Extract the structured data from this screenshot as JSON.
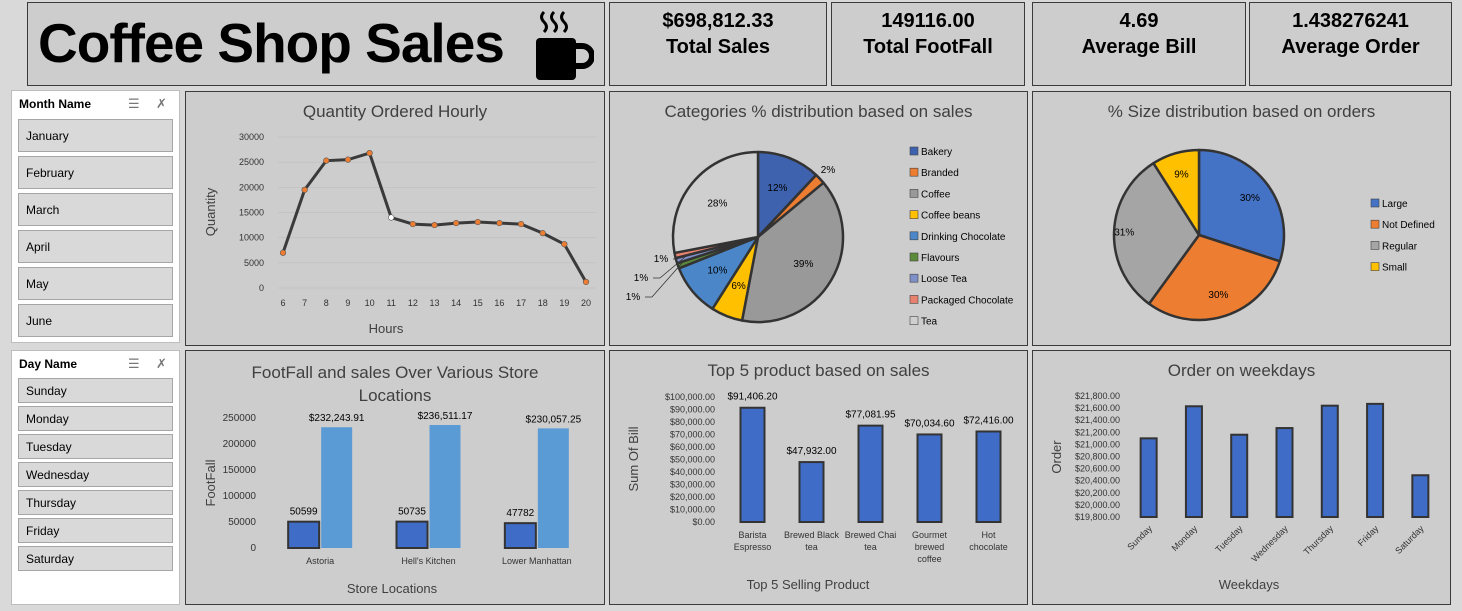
{
  "header": {
    "title": "Coffee Shop Sales",
    "icon": "coffee-cup-icon"
  },
  "kpis": [
    {
      "value": "$698,812.33",
      "label": "Total Sales"
    },
    {
      "value": "149116.00",
      "label": "Total FootFall"
    },
    {
      "value": "4.69",
      "label": "Average Bill"
    },
    {
      "value": "1.438276241",
      "label": "Average Order"
    }
  ],
  "slicer_month": {
    "title": "Month Name",
    "items": [
      "January",
      "February",
      "March",
      "April",
      "May",
      "June"
    ]
  },
  "slicer_day": {
    "title": "Day Name",
    "items": [
      "Sunday",
      "Monday",
      "Tuesday",
      "Wednesday",
      "Thursday",
      "Friday",
      "Saturday"
    ]
  },
  "colors": {
    "blue": "#4472c4",
    "orange": "#ed7d31",
    "gray": "#a5a5a5",
    "yellow": "#ffc000",
    "light_blue": "#5b9bd5",
    "green": "#70ad47",
    "bar_blue": "#3f6cc7"
  },
  "chart_data": [
    {
      "id": "hourly",
      "type": "line",
      "title": "Quantity Ordered Hourly",
      "xlabel": "Hours",
      "ylabel": "Quantity",
      "x": [
        6,
        7,
        8,
        9,
        10,
        11,
        12,
        13,
        14,
        15,
        16,
        17,
        18,
        19,
        20
      ],
      "values": [
        7000,
        19500,
        25300,
        25500,
        26800,
        14000,
        12700,
        12500,
        12900,
        13100,
        12900,
        12700,
        10900,
        8700,
        1200
      ],
      "yticks": [
        "0",
        "5000",
        "10000",
        "15000",
        "20000",
        "25000",
        "30000"
      ],
      "ylim": [
        0,
        30000
      ]
    },
    {
      "id": "categories",
      "type": "pie",
      "title": "Categories % distribution based on sales",
      "categories": [
        "Bakery",
        "Branded",
        "Coffee",
        "Coffee beans",
        "Drinking Chocolate",
        "Flavours",
        "Loose Tea",
        "Packaged Chocolate",
        "Tea"
      ],
      "values": [
        12,
        2,
        39,
        6,
        10,
        1,
        1,
        1,
        28
      ],
      "labels": [
        "12%",
        "2%",
        "39%",
        "6%",
        "10%",
        "1%",
        "1%",
        "1%",
        "28%"
      ],
      "colors": [
        "#3e62ad",
        "#ed7d31",
        "#999999",
        "#ffc000",
        "#4a86c8",
        "#5b8a3a",
        "#7f8fc8",
        "#e8826f",
        "#cfcfcf"
      ],
      "legend": "right"
    },
    {
      "id": "sizes",
      "type": "pie",
      "title": "% Size distribution based on orders",
      "categories": [
        "Large",
        "Not Defined",
        "Regular",
        "Small"
      ],
      "values": [
        30,
        30,
        31,
        9
      ],
      "labels": [
        "30%",
        "30%",
        "31%",
        "9%"
      ],
      "colors": [
        "#4472c4",
        "#ed7d31",
        "#a5a5a5",
        "#ffc000"
      ],
      "legend": "right"
    },
    {
      "id": "footfall",
      "type": "bar",
      "title": "FootFall and sales Over Various Store Locations",
      "xlabel": "Store Locations",
      "ylabel": "FootFall",
      "categories": [
        "Astoria",
        "Hell's Kitchen",
        "Lower Manhattan"
      ],
      "series": [
        {
          "values": [
            50599,
            50735,
            47782
          ],
          "labels": [
            "50599",
            "50735",
            "47782"
          ]
        },
        {
          "values": [
            232243.91,
            236511.17,
            230057.25
          ],
          "labels": [
            "$232,243.91",
            "$236,511.17",
            "$230,057.25"
          ]
        }
      ],
      "yticks": [
        "0",
        "50000",
        "100000",
        "150000",
        "200000",
        "250000"
      ],
      "ylim": [
        0,
        250000
      ]
    },
    {
      "id": "top5",
      "type": "bar",
      "title": "Top 5 product based on sales",
      "xlabel": "Top 5 Selling Product",
      "ylabel": "Sum Of Bill",
      "categories": [
        [
          "Barista",
          "Espresso"
        ],
        [
          "Brewed Black",
          "tea"
        ],
        [
          "Brewed Chai",
          "tea"
        ],
        [
          "Gourmet",
          "brewed",
          "coffee"
        ],
        [
          "Hot",
          "chocolate"
        ]
      ],
      "values": [
        91406.2,
        47932.0,
        77081.95,
        70034.6,
        72416.0
      ],
      "labels": [
        "$91,406.20",
        "$47,932.00",
        "$77,081.95",
        "$70,034.60",
        "$72,416.00"
      ],
      "yticks": [
        "$0.00",
        "$10,000.00",
        "$20,000.00",
        "$30,000.00",
        "$40,000.00",
        "$50,000.00",
        "$60,000.00",
        "$70,000.00",
        "$80,000.00",
        "$90,000.00",
        "$100,000.00"
      ],
      "ylim": [
        0,
        100000
      ]
    },
    {
      "id": "weekday",
      "type": "bar",
      "title": "Order on weekdays",
      "xlabel": "Weekdays",
      "ylabel": "Order",
      "categories": [
        "Sunday",
        "Monday",
        "Tuesday",
        "Wednesday",
        "Thursday",
        "Friday",
        "Saturday"
      ],
      "values": [
        21100,
        21630,
        21160,
        21270,
        21640,
        21670,
        20490
      ],
      "yticks": [
        "$19,800.00",
        "$20,000.00",
        "$20,200.00",
        "$20,400.00",
        "$20,600.00",
        "$20,800.00",
        "$21,000.00",
        "$21,200.00",
        "$21,400.00",
        "$21,600.00",
        "$21,800.00"
      ],
      "ylim": [
        19800,
        21800
      ]
    }
  ]
}
